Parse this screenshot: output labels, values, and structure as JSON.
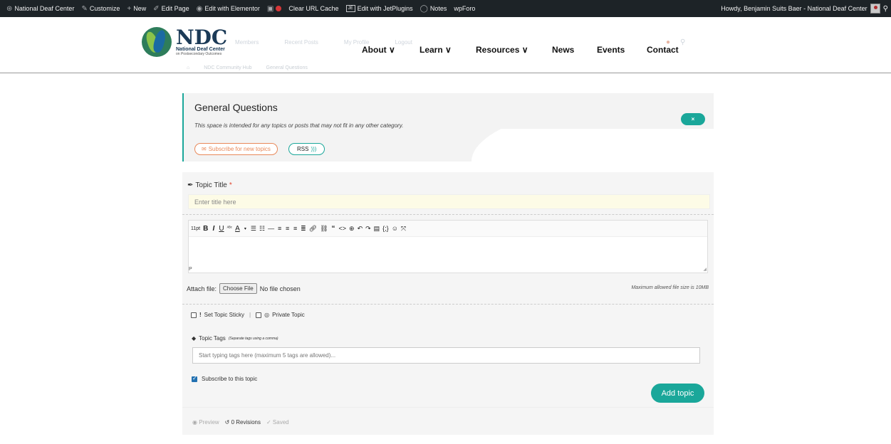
{
  "adminbar": {
    "items": [
      {
        "icon": "wordpress-icon",
        "label": "National Deaf Center"
      },
      {
        "icon": "brush-icon",
        "label": "Customize"
      },
      {
        "icon": "plus-icon",
        "label": "New"
      },
      {
        "icon": "pencil-icon",
        "label": "Edit Page"
      },
      {
        "icon": "elementor-icon",
        "label": "Edit with Elementor"
      },
      {
        "icon": "yoast-icon",
        "label": ""
      },
      {
        "icon": "record-icon",
        "label": "Clear URL Cache"
      },
      {
        "icon": "jetplugins-icon",
        "label": "Edit with JetPlugins"
      },
      {
        "icon": "comment-icon",
        "label": "Notes"
      },
      {
        "icon": "",
        "label": "wpForo"
      }
    ],
    "howdy": "Howdy, Benjamin Suits Baer - National Deaf Center"
  },
  "logo": {
    "big": "NDC",
    "sub": "National Deaf Center",
    "sub2": "on Postsecondary Outcomes"
  },
  "ghostnav": [
    "Members",
    "Recent Posts",
    "My Profile",
    "Logout"
  ],
  "nav": {
    "about": "About ∨",
    "learn": "Learn ∨",
    "resources": "Resources ∨",
    "news": "News",
    "events": "Events",
    "contact": "Contact"
  },
  "breadcrumb": [
    "NDC Community Hub",
    "General Questions"
  ],
  "forum": {
    "title": "General Questions",
    "description": "This space is intended for any topics or posts that may not fit in any other category.",
    "subscribe_label": "Subscribe for new topics",
    "rss_label": "RSS",
    "close_label": "×"
  },
  "form": {
    "topic_title_label": "Topic Title",
    "required_mark": "*",
    "title_placeholder": "Enter title here",
    "font_size": "11pt",
    "editor_path": "P",
    "attach_label": "Attach file:",
    "choose_file": "Choose File",
    "no_file": "No file chosen",
    "max_size": "Maximum allowed file size is 10MB",
    "sticky_label": "Set Topic Sticky",
    "private_label": "Private Topic",
    "tags_label": "Topic Tags",
    "tags_hint": "(Separate tags using a comma)",
    "tags_placeholder": "Start typing tags here (maximum 5 tags are allowed)...",
    "subscribe_label": "Subscribe to this topic",
    "subscribe_checked": true,
    "submit_label": "Add topic",
    "preview_label": "Preview",
    "revisions_label": "0 Revisions",
    "saved_label": "Saved"
  },
  "colors": {
    "accent": "#1aa79a",
    "adminbar": "#1d2327",
    "subscribe": "#e8895a"
  }
}
